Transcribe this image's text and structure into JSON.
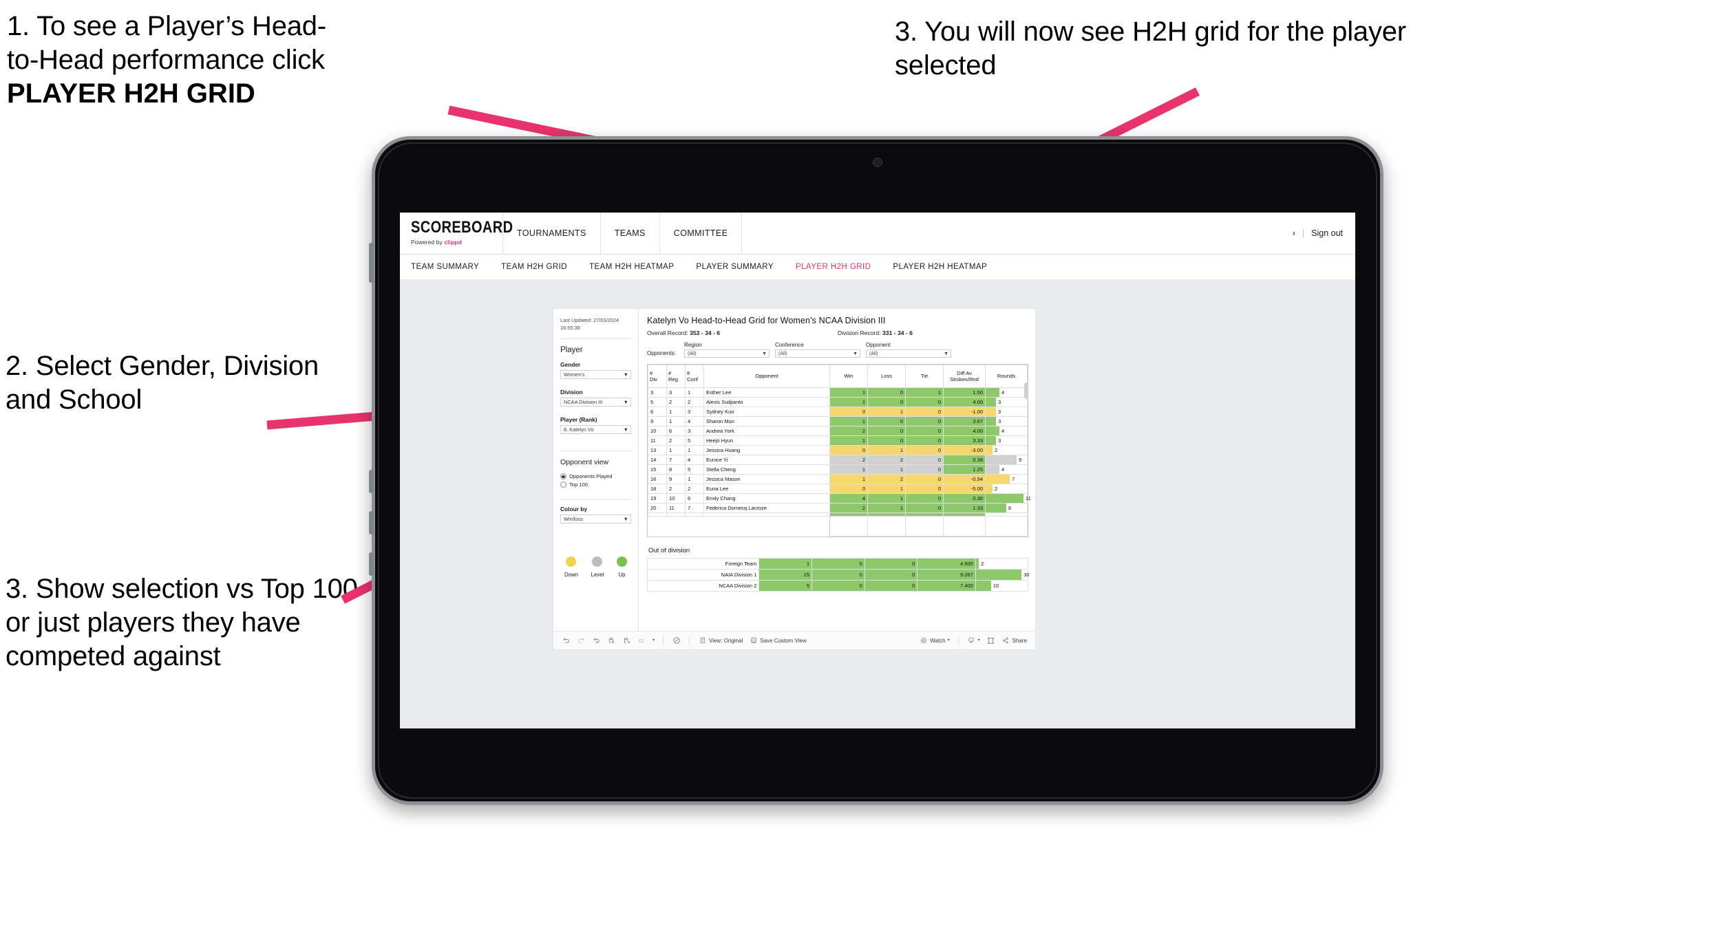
{
  "annotations": {
    "step1_line1": "1. To see a Player’s Head-",
    "step1_line2": "to-Head performance click",
    "step1_bold": "PLAYER H2H GRID",
    "step2": "2. Select Gender, Division and School",
    "step3_left": "3. Show selection vs Top 100 or just players they have competed against",
    "step3_right": "3. You will now see H2H grid for the player selected",
    "arrow_color": "#e8336d"
  },
  "browser": {
    "topnav": {
      "logo_title": "SCOREBOARD",
      "logo_sub_prefix": "Powered by ",
      "logo_sub_brand": "clippd",
      "items": [
        {
          "label": "TOURNAMENTS"
        },
        {
          "label": "TEAMS"
        },
        {
          "label": "COMMITTEE"
        }
      ],
      "right_chevron": "›",
      "right_separator": "|",
      "sign_out": "Sign out"
    },
    "subnav": {
      "items": [
        {
          "label": "TEAM SUMMARY",
          "active": false
        },
        {
          "label": "TEAM H2H GRID",
          "active": false
        },
        {
          "label": "TEAM H2H HEATMAP",
          "active": false
        },
        {
          "label": "PLAYER SUMMARY",
          "active": false
        },
        {
          "label": "PLAYER H2H GRID",
          "active": true
        },
        {
          "label": "PLAYER H2H HEATMAP",
          "active": false
        }
      ],
      "active_color": "#e8336d"
    }
  },
  "panel": {
    "last_updated": "Last Updated: 27/03/2024 16:55:38",
    "player_heading": "Player",
    "gender": {
      "label": "Gender",
      "value": "Women's"
    },
    "division": {
      "label": "Division",
      "value": "NCAA Division III"
    },
    "player_rank": {
      "label": "Player (Rank)",
      "value": "8. Katelyn Vo"
    },
    "opponent_view": {
      "heading": "Opponent view",
      "options": [
        {
          "label": "Opponents Played",
          "selected": true
        },
        {
          "label": "Top 100",
          "selected": false
        }
      ]
    },
    "colour_by": {
      "label": "Colour by",
      "value": "Win/loss"
    },
    "legend": [
      {
        "label": "Down",
        "color": "#f2d24b"
      },
      {
        "label": "Level",
        "color": "#bdbdbd"
      },
      {
        "label": "Up",
        "color": "#76c24a"
      }
    ]
  },
  "viz": {
    "title": "Katelyn Vo Head-to-Head Grid for Women’s NCAA Division III",
    "overall_record_label": "Overall Record:",
    "overall_record_value": "353 - 34 - 6",
    "division_record_label": "Division Record:",
    "division_record_value": "331 - 34 - 6",
    "opponents_label": "Opponents:",
    "filters": [
      {
        "label": "Region",
        "value": "(All)"
      },
      {
        "label": "Conference",
        "value": "(All)"
      },
      {
        "label": "Opponent",
        "value": "(All)"
      }
    ],
    "out_of_division_title": "Out of division"
  },
  "chart_data": {
    "type": "table",
    "title": "Katelyn Vo Head-to-Head Grid for Women’s NCAA Division III",
    "columns": [
      "# Div",
      "# Reg",
      "# Conf",
      "Opponent",
      "Win",
      "Loss",
      "Tie",
      "Diff Av Strokes/Rnd",
      "Rounds"
    ],
    "column_header_lines": [
      [
        "#",
        "Div"
      ],
      [
        "#",
        "Reg"
      ],
      [
        "#",
        "Conf"
      ],
      [
        "Opponent"
      ],
      [
        "Win"
      ],
      [
        "Loss"
      ],
      [
        "Tie"
      ],
      [
        "Diff Av",
        "Strokes/Rnd"
      ],
      [
        "Rounds"
      ]
    ],
    "colors": {
      "up": "#8dc96a",
      "down": "#f5d76e",
      "level": "#d0d0d0",
      "neutral": "#ffffff"
    },
    "rounds_max": 12,
    "rows": [
      {
        "div": "3",
        "reg": "3",
        "conf": "1",
        "opponent": "Esther Lee",
        "win": "1",
        "loss": "0",
        "tie": "1",
        "diff": "1.50",
        "rounds": "4",
        "rounds_num": 4,
        "state": "up"
      },
      {
        "div": "5",
        "reg": "2",
        "conf": "2",
        "opponent": "Alexis Sudjianto",
        "win": "1",
        "loss": "0",
        "tie": "0",
        "diff": "4.00",
        "rounds": "3",
        "rounds_num": 3,
        "state": "up"
      },
      {
        "div": "6",
        "reg": "1",
        "conf": "3",
        "opponent": "Sydney Kuo",
        "win": "0",
        "loss": "1",
        "tie": "0",
        "diff": "-1.00",
        "rounds": "3",
        "rounds_num": 3,
        "state": "down"
      },
      {
        "div": "9",
        "reg": "1",
        "conf": "4",
        "opponent": "Sharon Mun",
        "win": "1",
        "loss": "0",
        "tie": "0",
        "diff": "3.67",
        "rounds": "3",
        "rounds_num": 3,
        "state": "up"
      },
      {
        "div": "10",
        "reg": "6",
        "conf": "3",
        "opponent": "Andrea York",
        "win": "2",
        "loss": "0",
        "tie": "0",
        "diff": "4.00",
        "rounds": "4",
        "rounds_num": 4,
        "state": "up"
      },
      {
        "div": "11",
        "reg": "2",
        "conf": "5",
        "opponent": "Heejo Hyun",
        "win": "1",
        "loss": "0",
        "tie": "0",
        "diff": "3.33",
        "rounds": "3",
        "rounds_num": 3,
        "state": "up"
      },
      {
        "div": "13",
        "reg": "1",
        "conf": "1",
        "opponent": "Jessica Huang",
        "win": "0",
        "loss": "1",
        "tie": "0",
        "diff": "-3.00",
        "rounds": "2",
        "rounds_num": 2,
        "state": "down"
      },
      {
        "div": "14",
        "reg": "7",
        "conf": "4",
        "opponent": "Eunice Yi",
        "win": "2",
        "loss": "2",
        "tie": "0",
        "diff": "0.38",
        "rounds": "9",
        "rounds_num": 9,
        "state": "level",
        "diff_state": "up"
      },
      {
        "div": "15",
        "reg": "8",
        "conf": "5",
        "opponent": "Stella Cheng",
        "win": "1",
        "loss": "1",
        "tie": "0",
        "diff": "1.25",
        "rounds": "4",
        "rounds_num": 4,
        "state": "level",
        "diff_state": "up"
      },
      {
        "div": "16",
        "reg": "9",
        "conf": "1",
        "opponent": "Jessica Mason",
        "win": "1",
        "loss": "2",
        "tie": "0",
        "diff": "-0.94",
        "rounds": "7",
        "rounds_num": 7,
        "state": "down"
      },
      {
        "div": "18",
        "reg": "2",
        "conf": "2",
        "opponent": "Euna Lee",
        "win": "0",
        "loss": "1",
        "tie": "0",
        "diff": "-5.00",
        "rounds": "2",
        "rounds_num": 2,
        "state": "down"
      },
      {
        "div": "19",
        "reg": "10",
        "conf": "6",
        "opponent": "Emily Chang",
        "win": "4",
        "loss": "1",
        "tie": "0",
        "diff": "0.30",
        "rounds": "11",
        "rounds_num": 11,
        "state": "up"
      },
      {
        "div": "20",
        "reg": "11",
        "conf": "7",
        "opponent": "Federica Domecq Lacroze",
        "win": "2",
        "loss": "1",
        "tie": "0",
        "diff": "1.33",
        "rounds": "6",
        "rounds_num": 6,
        "state": "up"
      }
    ],
    "out_of_division": {
      "rounds_max": 34,
      "rows": [
        {
          "name": "Foreign Team",
          "win": "1",
          "loss": "0",
          "tie": "0",
          "diff": "4.500",
          "rounds": "2",
          "rounds_num": 2,
          "state": "up"
        },
        {
          "name": "NAIA Division 1",
          "win": "15",
          "loss": "0",
          "tie": "0",
          "diff": "9.267",
          "rounds": "30",
          "rounds_num": 30,
          "state": "up"
        },
        {
          "name": "NCAA Division 2",
          "win": "5",
          "loss": "0",
          "tie": "0",
          "diff": "7.400",
          "rounds": "10",
          "rounds_num": 10,
          "state": "up"
        }
      ]
    }
  },
  "toolbar": {
    "view_original": "View: Original",
    "save_custom_view": "Save Custom View",
    "watch": "Watch",
    "share": "Share",
    "caret": "▾"
  }
}
